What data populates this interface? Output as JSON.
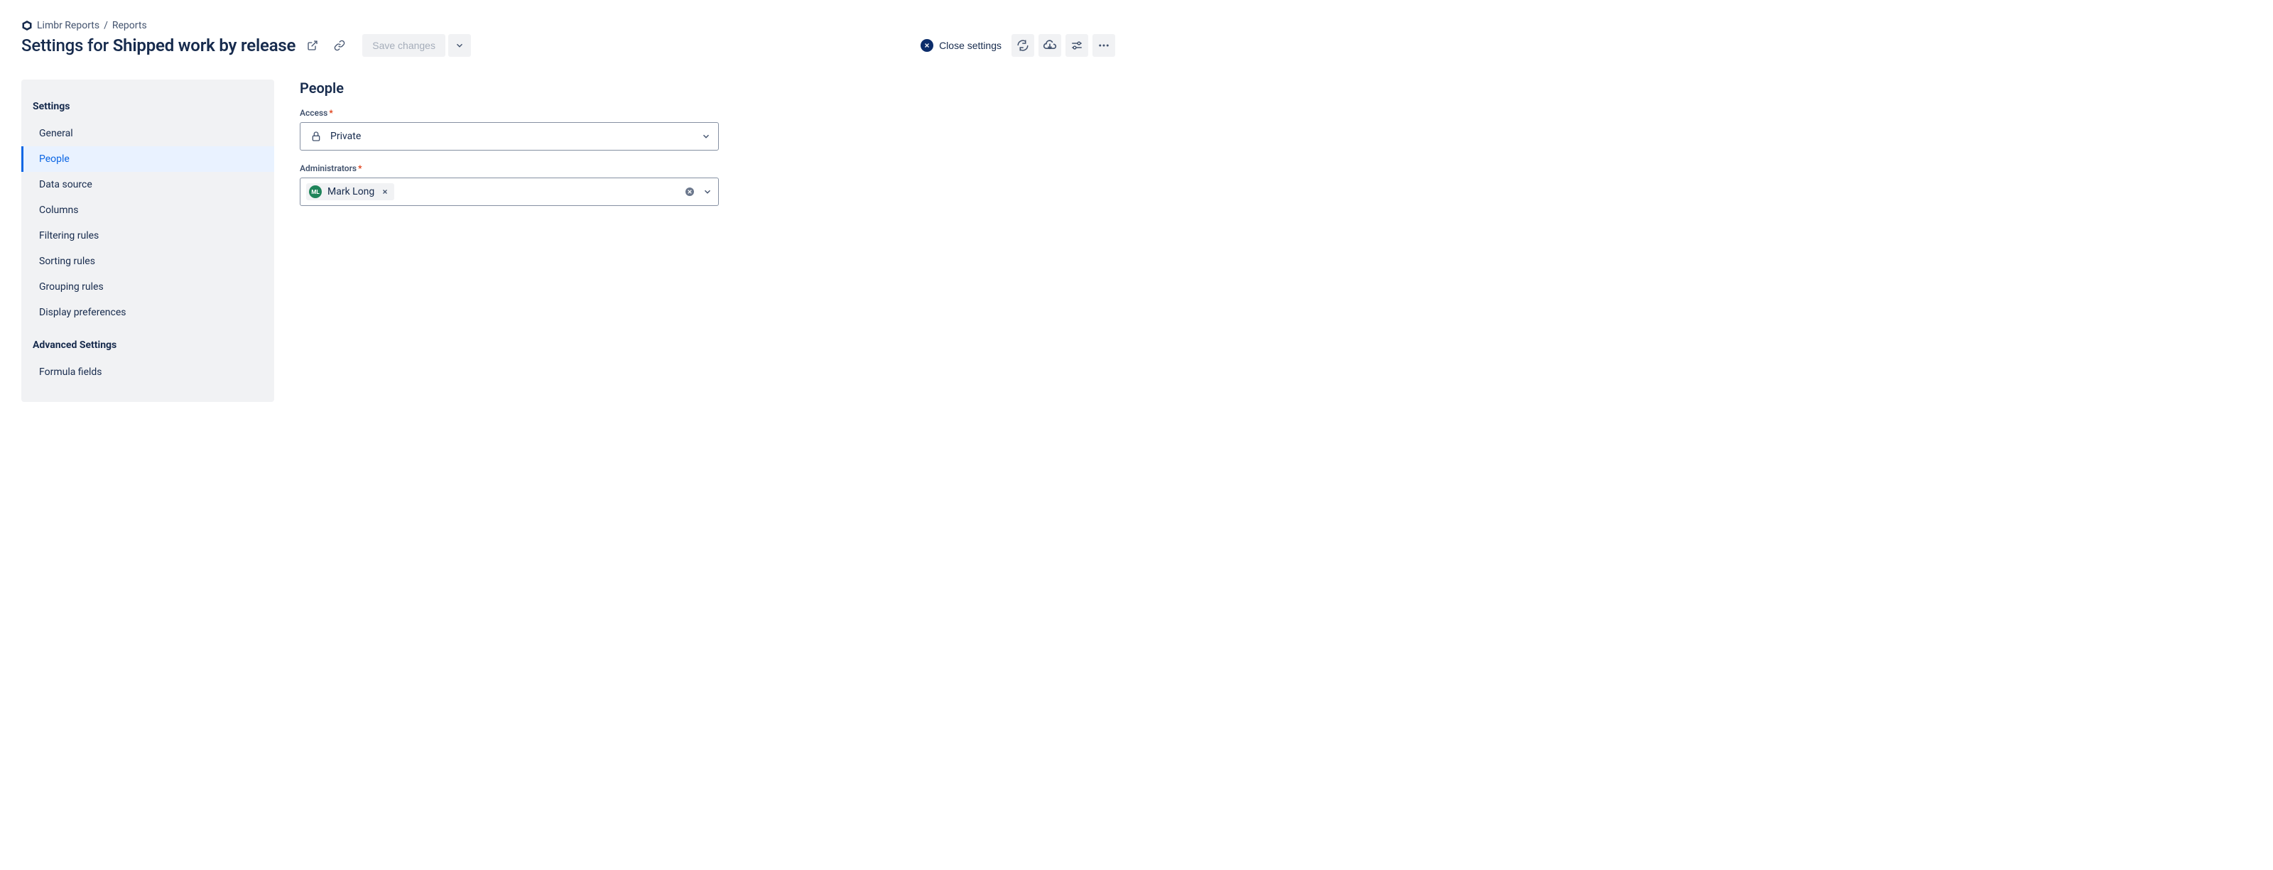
{
  "breadcrumb": {
    "root": "Limbr Reports",
    "current": "Reports"
  },
  "header": {
    "title_prefix": "Settings for ",
    "title_name": "Shipped work by release",
    "save_label": "Save changes",
    "close_label": "Close settings"
  },
  "sidebar": {
    "heading_settings": "Settings",
    "heading_advanced": "Advanced Settings",
    "items": {
      "general": "General",
      "people": "People",
      "data_source": "Data source",
      "columns": "Columns",
      "filtering": "Filtering rules",
      "sorting": "Sorting rules",
      "grouping": "Grouping rules",
      "display": "Display preferences",
      "formula": "Formula fields"
    }
  },
  "main": {
    "section_title": "People",
    "access": {
      "label": "Access",
      "value": "Private"
    },
    "administrators": {
      "label": "Administrators",
      "chips": [
        {
          "name": "Mark Long",
          "initials": "ML"
        }
      ]
    }
  }
}
